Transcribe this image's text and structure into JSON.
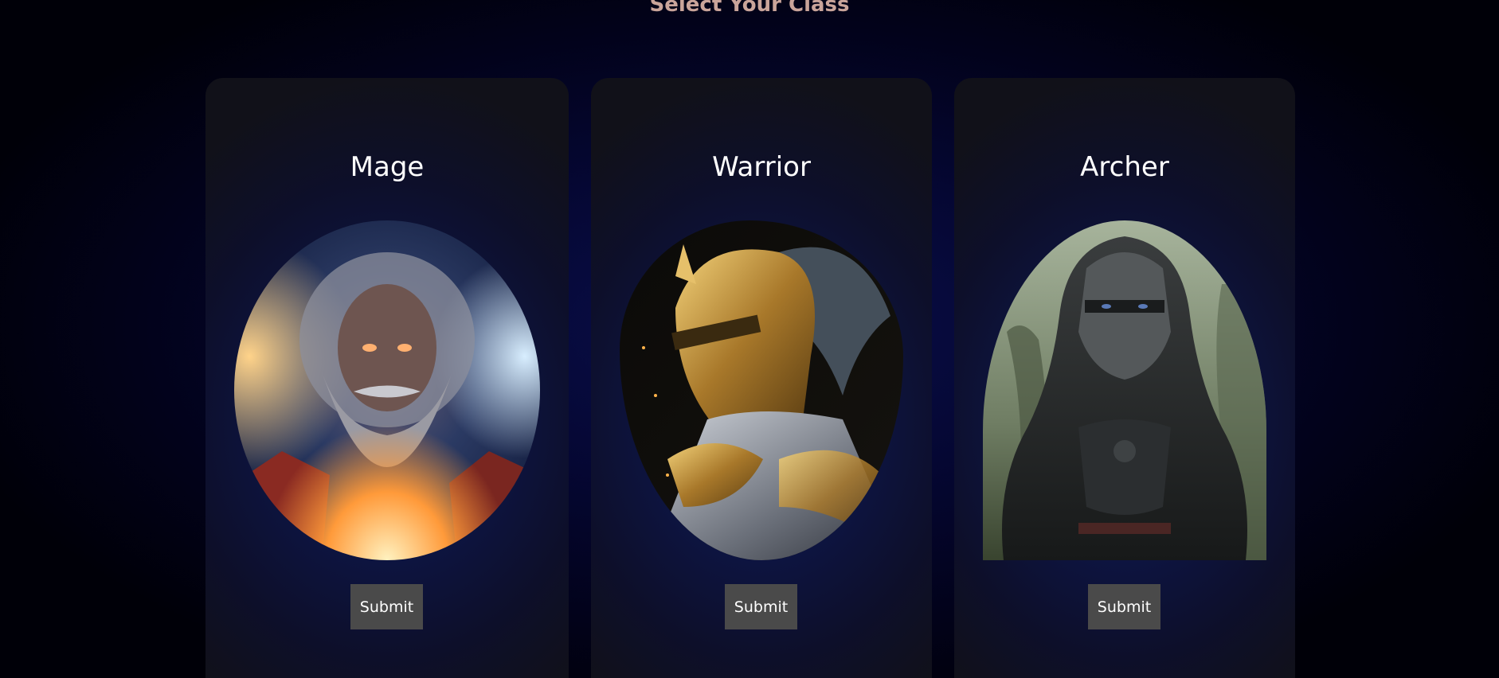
{
  "page": {
    "title": "Select Your Class"
  },
  "classes": [
    {
      "name": "Mage",
      "button_label": "Submit",
      "portrait_icon": "mage-portrait"
    },
    {
      "name": "Warrior",
      "button_label": "Submit",
      "portrait_icon": "warrior-portrait"
    },
    {
      "name": "Archer",
      "button_label": "Submit",
      "portrait_icon": "archer-portrait"
    }
  ],
  "colors": {
    "background": "#000008",
    "card": "#0d1545",
    "title": "#c9a49a",
    "button": "#4a4a4a"
  }
}
